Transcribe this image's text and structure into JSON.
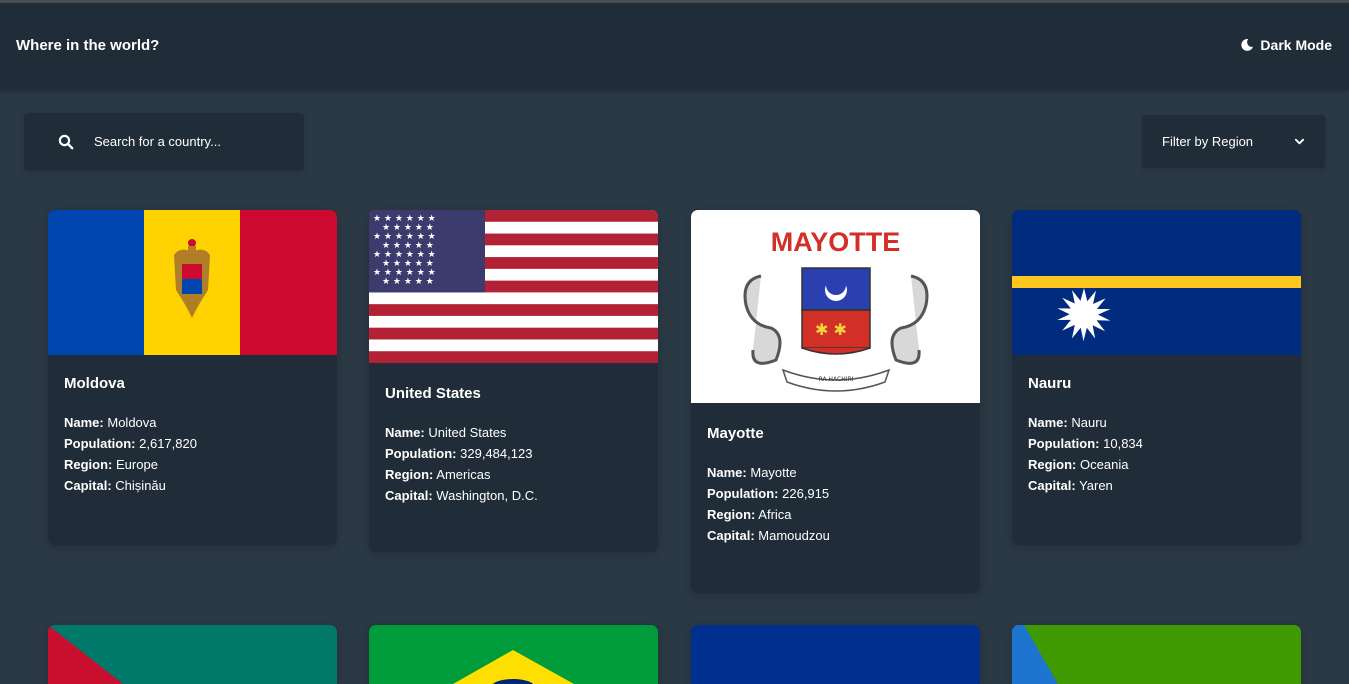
{
  "header": {
    "title": "Where in the world?",
    "mode_label": "Dark Mode",
    "mode_icon": "moon-icon"
  },
  "search": {
    "placeholder": "Search for a country...",
    "icon": "search-icon"
  },
  "filter": {
    "label": "Filter by Region",
    "icon": "chevron-down-icon"
  },
  "field_labels": {
    "name": "Name:",
    "population": "Population:",
    "region": "Region:",
    "capital": "Capital:"
  },
  "countries": [
    {
      "name": "Moldova",
      "population": "2,617,820",
      "region": "Europe",
      "capital": "Chișinău"
    },
    {
      "name": "United States",
      "population": "329,484,123",
      "region": "Americas",
      "capital": "Washington, D.C."
    },
    {
      "name": "Mayotte",
      "population": "226,915",
      "region": "Africa",
      "capital": "Mamoudzou",
      "flag_text": "MAYOTTE",
      "flag_motto": "RA HACHIRI"
    },
    {
      "name": "Nauru",
      "population": "10,834",
      "region": "Oceania",
      "capital": "Yaren"
    }
  ],
  "colors": {
    "background": "#2b3945",
    "elements": "#202c37",
    "text": "#ffffff"
  }
}
